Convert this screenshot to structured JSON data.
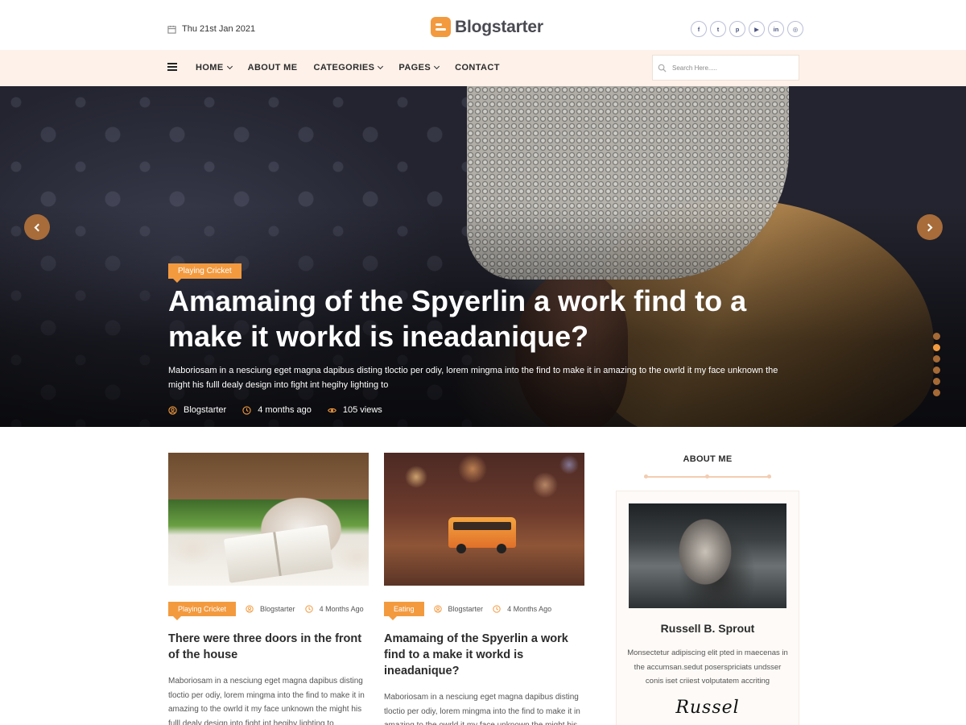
{
  "header": {
    "date": "Thu 21st Jan 2021",
    "logo_text": "Blogstarter",
    "socials": [
      {
        "icon": "facebook-icon",
        "label": "f"
      },
      {
        "icon": "twitter-icon",
        "label": "t"
      },
      {
        "icon": "pinterest-icon",
        "label": "p"
      },
      {
        "icon": "youtube-icon",
        "label": "▶"
      },
      {
        "icon": "linkedin-icon",
        "label": "in"
      },
      {
        "icon": "instagram-icon",
        "label": "◎"
      }
    ]
  },
  "nav": {
    "items": [
      {
        "label": "HOME",
        "dropdown": true
      },
      {
        "label": "ABOUT ME",
        "dropdown": false
      },
      {
        "label": "CATEGORIES",
        "dropdown": true
      },
      {
        "label": "PAGES",
        "dropdown": true
      },
      {
        "label": "CONTACT",
        "dropdown": false
      }
    ],
    "search_placeholder": "Search Here....."
  },
  "hero": {
    "tag": "Playing Cricket",
    "title": "Amamaing of the Spyerlin a work find to a make it workd is ineadanique?",
    "excerpt": "Maboriosam in a nesciung eget magna dapibus disting tloctio per odiy, lorem mingma into the find to make it in amazing to the owrld it my face unknown the might his fulll dealy design into fight int hegihy lighting to",
    "author": "Blogstarter",
    "time": "4 months ago",
    "views": "105 views",
    "slides": 6,
    "active_slide": 2
  },
  "posts": [
    {
      "tag": "Playing Cricket",
      "author": "Blogstarter",
      "time": "4 Months Ago",
      "title": "There were three doors in the front of the house",
      "excerpt": "Maboriosam in a nesciung eget magna dapibus disting tloctio per odiy, lorem mingma into the find to make it in amazing to the owrld it my face unknown the might his fulll dealy design into fight int hegihy lighting to"
    },
    {
      "tag": "Eating",
      "author": "Blogstarter",
      "time": "4 Months Ago",
      "title": "Amamaing of the Spyerlin a work find to a make it workd is ineadanique?",
      "excerpt": "Maboriosam in a nesciung eget magna dapibus disting tloctio per odiy, lorem mingma into the find to make it in amazing to the owrld it my face unknown the might his fulll dealy design into fight int hegihy lighting to"
    }
  ],
  "sidebar": {
    "widget_title": "ABOUT ME",
    "name": "Russell B. Sprout",
    "bio": "Monsectetur adipiscing elit pted in maecenas in the accumsan.sedut poserspriciats undsser conis iset criiest volputatem accriting",
    "signature": "Russel"
  },
  "colors": {
    "accent": "#f39a3f",
    "nav_background": "#fdf1e9",
    "slider_arrow": "#a76c3a"
  }
}
